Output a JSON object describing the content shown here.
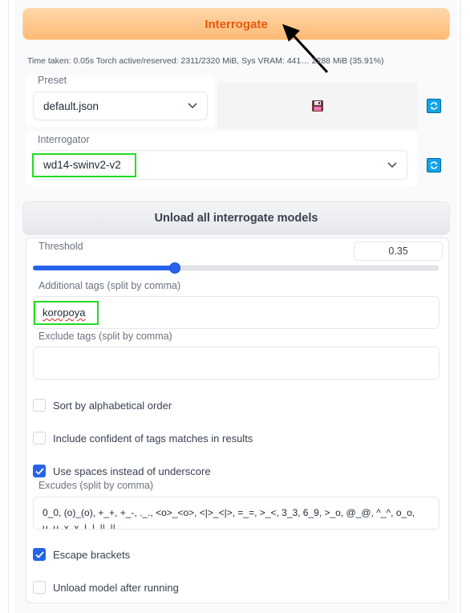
{
  "interrogate_button": {
    "label": "Interrogate"
  },
  "status": {
    "timing": "Time taken: 0.05s  Torch active/reserved: 2311/2320 MiB, Sys VRAM: 441… 2288 MiB (35.91%)"
  },
  "preset": {
    "label": "Preset",
    "value": "default.json",
    "save_icon": "floppy-disk-icon"
  },
  "interrogator": {
    "label": "Interrogator",
    "value": "wd14-swinv2-v2"
  },
  "unload_button": {
    "label": "Unload all interrogate models"
  },
  "threshold": {
    "label": "Threshold",
    "value": "0.35",
    "fraction": 0.35
  },
  "additional_tags": {
    "label": "Additional tags (split by comma)",
    "value": "koropoya"
  },
  "exclude_tags": {
    "label": "Exclude tags (split by comma)",
    "value": ""
  },
  "options": {
    "sort_alpha": {
      "label": "Sort by alphabetical order",
      "checked": false
    },
    "include_confident": {
      "label": "Include confident of tags matches in results",
      "checked": false
    },
    "use_spaces": {
      "label": "Use spaces instead of underscore",
      "checked": true
    },
    "escape_brackets": {
      "label": "Escape brackets",
      "checked": true
    },
    "unload_after": {
      "label": "Unload model after running",
      "checked": false
    }
  },
  "excludes": {
    "label": "Excudes (split by comma)",
    "value": "0_0, (o)_(o), +_+, +_-, ._., <o>_<o>, <|>_<|>, =_=, >_<, 3_3, 6_9, >_o, @_@, ^_^, o_o,",
    "value_line2": "u_u, x_x, |_|, ||_||"
  },
  "colors": {
    "accent": "#2563eb",
    "primary_orange": "#ea580c",
    "highlight_green": "#22dd22"
  }
}
